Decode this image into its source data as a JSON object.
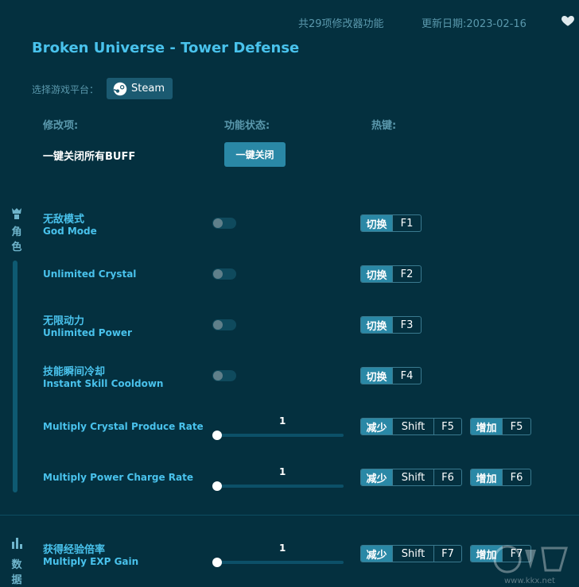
{
  "header": {
    "feature_count": "共29项修改器功能",
    "update_date": "更新日期:2023-02-16"
  },
  "game": {
    "title": "Broken Universe - Tower Defense"
  },
  "platform": {
    "label": "选择游戏平台：",
    "selected": "Steam"
  },
  "columns": {
    "item": "修改项:",
    "status": "功能状态:",
    "hotkey": "热键:"
  },
  "disable_all": {
    "label": "一键关闭所有BUFF",
    "button": "一键关闭"
  },
  "categories": [
    {
      "icon": "character-icon",
      "label_line1": "角",
      "label_line2": "色"
    },
    {
      "icon": "data-icon",
      "label_line1": "数",
      "label_line2": "据"
    }
  ],
  "key_labels": {
    "toggle": "切换",
    "decrease": "减少",
    "increase": "增加",
    "shift": "Shift"
  },
  "toggles": [
    {
      "cn": "无敌模式",
      "en": "God Mode",
      "key": "F1",
      "on": false
    },
    {
      "cn": "",
      "en": "Unlimited Crystal",
      "key": "F2",
      "on": false
    },
    {
      "cn": "无限动力",
      "en": "Unlimited Power",
      "key": "F3",
      "on": false
    },
    {
      "cn": "技能瞬间冷却",
      "en": "Instant Skill Cooldown",
      "key": "F4",
      "on": false
    }
  ],
  "sliders": [
    {
      "cn": "",
      "en": "Multiply Crystal Produce Rate",
      "value": "1",
      "dec_key": "F5",
      "inc_key": "F5"
    },
    {
      "cn": "",
      "en": "Multiply Power Charge Rate",
      "value": "1",
      "dec_key": "F6",
      "inc_key": "F6"
    },
    {
      "cn": "获得经验倍率",
      "en": "Multiply EXP Gain",
      "value": "1",
      "dec_key": "F7",
      "inc_key": "F7"
    }
  ],
  "watermark": {
    "text": "www.kkx.net"
  },
  "colors": {
    "background": "#04303f",
    "accent": "#49c2ec",
    "button": "#2a88a6",
    "muted": "#5a98ac"
  }
}
